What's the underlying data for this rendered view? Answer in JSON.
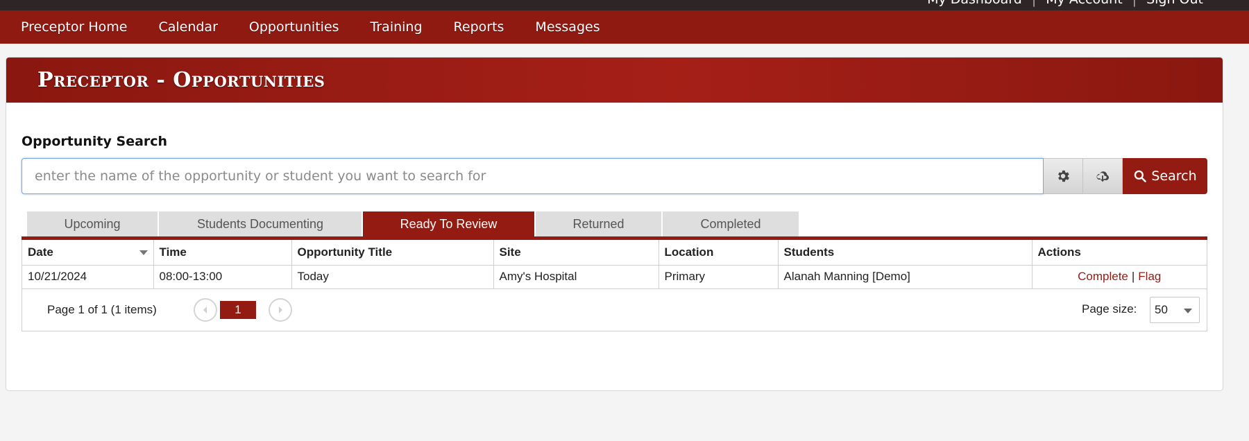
{
  "top_links": {
    "dashboard": "My Dashboard",
    "account": "My Account",
    "signout": "Sign Out",
    "separator": "|"
  },
  "nav": {
    "items": [
      {
        "label": "Preceptor Home"
      },
      {
        "label": "Calendar"
      },
      {
        "label": "Opportunities"
      },
      {
        "label": "Training"
      },
      {
        "label": "Reports"
      },
      {
        "label": "Messages"
      }
    ]
  },
  "page": {
    "title": "Preceptor - Opportunities"
  },
  "search": {
    "label": "Opportunity Search",
    "value": "",
    "placeholder": "enter the name of the opportunity or student you want to search for",
    "settings_icon": "gear-icon",
    "download_icon": "cloud-download-icon",
    "button_icon": "search-icon",
    "button_label": "Search"
  },
  "tabs": [
    {
      "label": "Upcoming",
      "active": false
    },
    {
      "label": "Students Documenting",
      "active": false
    },
    {
      "label": "Ready To Review",
      "active": true
    },
    {
      "label": "Returned",
      "active": false
    },
    {
      "label": "Completed",
      "active": false
    }
  ],
  "grid": {
    "columns": [
      "Date",
      "Time",
      "Opportunity Title",
      "Site",
      "Location",
      "Students",
      "Actions"
    ],
    "rows": [
      {
        "date": "10/21/2024",
        "time": "08:00-13:00",
        "title": "Today",
        "site": "Amy's Hospital",
        "location": "Primary",
        "students": "Alanah Manning [Demo]",
        "actions": {
          "complete": "Complete",
          "separator": "|",
          "flag": "Flag"
        }
      }
    ]
  },
  "pager": {
    "info": "Page 1 of 1 (1 items)",
    "current_page": "1",
    "page_size_label": "Page size:",
    "page_size": "50"
  },
  "colors": {
    "brand": "#931b12",
    "topbar": "#2e2626",
    "page_bg": "#f4f4f4"
  }
}
